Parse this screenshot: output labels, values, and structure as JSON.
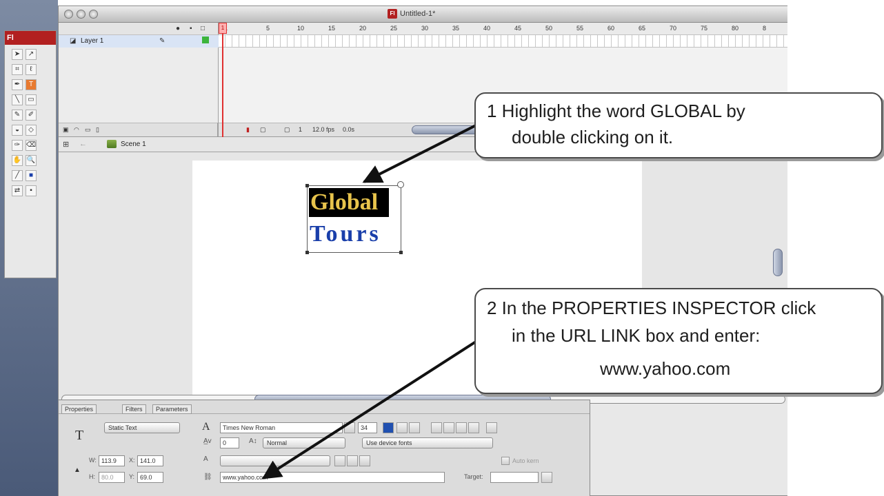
{
  "window": {
    "title": "Untitled-1*",
    "app_badge": "Fl"
  },
  "timeline": {
    "layer_name": "Layer 1",
    "ruler_numbers": [
      "1",
      "5",
      "10",
      "15",
      "20",
      "25",
      "30",
      "35",
      "40",
      "45",
      "50",
      "55",
      "60",
      "65",
      "70",
      "75",
      "80",
      "8"
    ],
    "status": {
      "frame": "1",
      "fps": "12.0 fps",
      "time": "0.0s"
    }
  },
  "edit_bar": {
    "scene_label": "Scene 1"
  },
  "stage": {
    "text_line1": "Global",
    "text_line2": "Tours"
  },
  "properties": {
    "tabs": [
      "Properties",
      "Filters",
      "Parameters"
    ],
    "text_type": "Static Text",
    "font_family": "Times New Roman",
    "font_size": "34",
    "letter_spacing": "0",
    "baseline": "Normal",
    "rendering": "Use device fonts",
    "w_label": "W:",
    "w_value": "113.9",
    "h_label": "H:",
    "h_value": "80.0",
    "x_label": "X:",
    "x_value": "141.0",
    "y_label": "Y:",
    "y_value": "69.0",
    "url_link": "www.yahoo.com",
    "target_label": "Target:",
    "auto_kern_label": "Auto kern"
  },
  "callouts": {
    "step1_line1": "1  Highlight the word GLOBAL by",
    "step1_line2": "double clicking on it.",
    "step2_line1": "2  In the PROPERTIES INSPECTOR click",
    "step2_line2": "in the URL LINK box and enter:",
    "step2_line3": "www.yahoo.com"
  },
  "colors": {
    "accent_red": "#b22020",
    "highlight_text": "#e8c44c",
    "tours_blue": "#1a3faa"
  }
}
